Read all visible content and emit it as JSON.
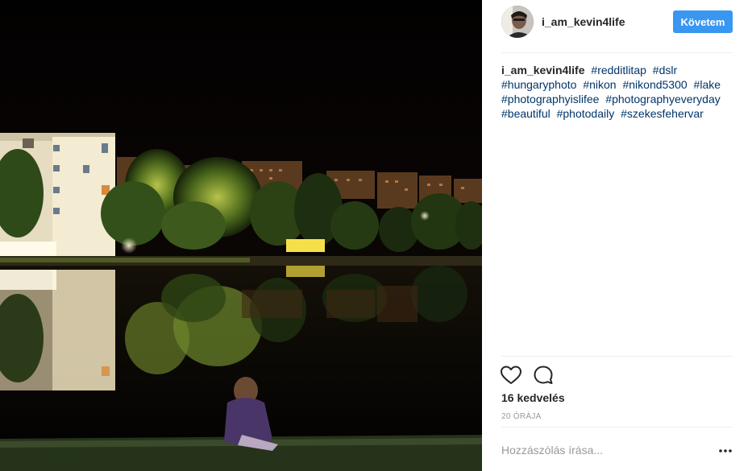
{
  "post": {
    "photo_alt": "Night view of a lake reflecting trees and lit buildings, a person sitting at the shore"
  },
  "header": {
    "username": "i_am_kevin4life",
    "follow_label": "Követem",
    "follow_color": "#3897f0"
  },
  "caption": {
    "username": "i_am_kevin4life",
    "hashtags": [
      "#redditlitap",
      "#dslr",
      "#hungaryphoto",
      "#nikon",
      "#nikond5300",
      "#lake",
      "#photographyislifee",
      "#photographyeveryday",
      "#beautiful",
      "#photodaily",
      "#szekesfehervar"
    ],
    "hashtag_color": "#003569"
  },
  "actions": {
    "like_icon": "heart-icon",
    "comment_icon": "comment-icon"
  },
  "stats": {
    "likes_text": "16 kedvelés",
    "time_text": "20 ÓRÁJA"
  },
  "comment_box": {
    "placeholder": "Hozzászólás írása...",
    "more_icon": "more-options-icon"
  }
}
